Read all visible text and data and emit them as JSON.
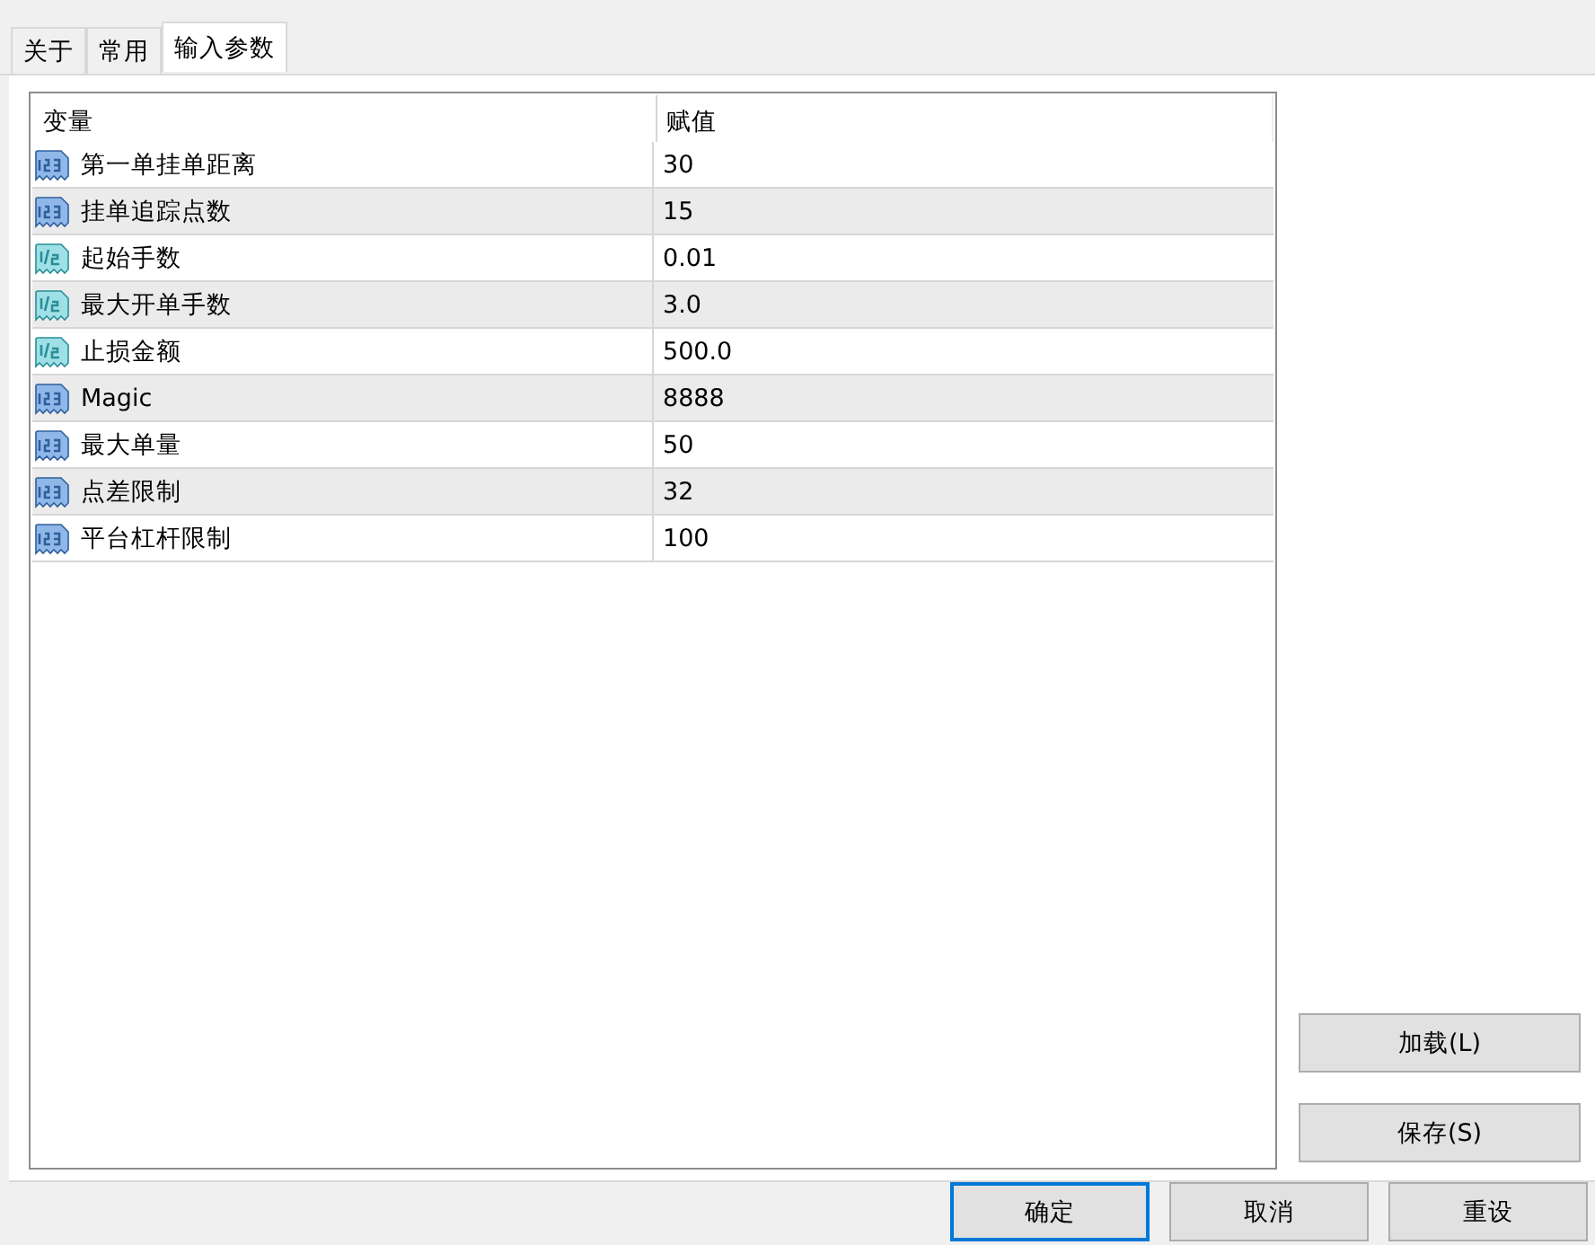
{
  "tabs": [
    {
      "label": "关于",
      "selected": false
    },
    {
      "label": "常用",
      "selected": false
    },
    {
      "label": "输入参数",
      "selected": true
    }
  ],
  "table": {
    "columns": [
      "变量",
      "赋值"
    ],
    "rows": [
      {
        "kind": "integer",
        "name": "第一单挂单距离",
        "value": "30"
      },
      {
        "kind": "integer",
        "name": "挂单追踪点数",
        "value": "15"
      },
      {
        "kind": "double",
        "name": "起始手数",
        "value": "0.01"
      },
      {
        "kind": "double",
        "name": "最大开单手数",
        "value": "3.0"
      },
      {
        "kind": "double",
        "name": "止损金额",
        "value": "500.0"
      },
      {
        "kind": "integer",
        "name": "Magic",
        "value": "8888"
      },
      {
        "kind": "integer",
        "name": "最大单量",
        "value": "50"
      },
      {
        "kind": "integer",
        "name": "点差限制",
        "value": "32"
      },
      {
        "kind": "integer",
        "name": "平台杠杆限制",
        "value": "100"
      }
    ]
  },
  "side_buttons": [
    "加载(L)",
    "保存(S)"
  ],
  "buttons": [
    {
      "label": "确定",
      "default": true
    },
    {
      "label": "取消",
      "default": false
    },
    {
      "label": "重设",
      "default": false
    }
  ]
}
